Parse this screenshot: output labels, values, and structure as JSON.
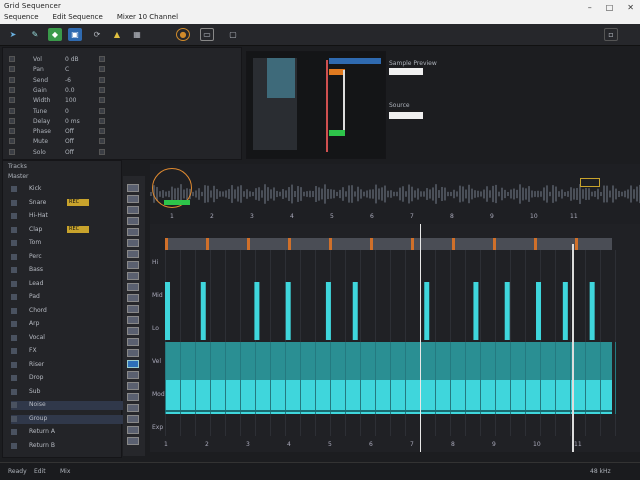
{
  "window": {
    "title": "Grid Sequencer",
    "menu": [
      "Sequence",
      "Edit Sequence",
      "Mixer 10 Channel"
    ]
  },
  "toolbar": {
    "icons": [
      "cursor-icon",
      "pencil-icon",
      "snap-icon",
      "save-icon",
      "loop-icon",
      "metronome-icon",
      "record-icon",
      "settings-icon",
      "grid-icon",
      "window-icon"
    ]
  },
  "inspector": {
    "rows": [
      {
        "label": "Vol",
        "value": "0 dB"
      },
      {
        "label": "Pan",
        "value": "C"
      },
      {
        "label": "Send",
        "value": "-6"
      },
      {
        "label": "Gain",
        "value": "0.0"
      },
      {
        "label": "Width",
        "value": "100"
      },
      {
        "label": "Tune",
        "value": "0"
      },
      {
        "label": "Delay",
        "value": "0 ms"
      },
      {
        "label": "Phase",
        "value": "Off"
      },
      {
        "label": "Mute",
        "value": "Off"
      },
      {
        "label": "Solo",
        "value": "Off"
      }
    ]
  },
  "preview": {
    "label_a": "Sample Preview",
    "label_b": "Source"
  },
  "tracks": {
    "header": "Tracks",
    "sub": "Master",
    "items": [
      {
        "name": "Kick",
        "badge": ""
      },
      {
        "name": "Snare",
        "badge": "REC"
      },
      {
        "name": "Hi-Hat",
        "badge": ""
      },
      {
        "name": "Clap",
        "badge": "REC"
      },
      {
        "name": "Tom",
        "badge": ""
      },
      {
        "name": "Perc",
        "badge": ""
      },
      {
        "name": "Bass",
        "badge": ""
      },
      {
        "name": "Lead",
        "badge": ""
      },
      {
        "name": "Pad",
        "badge": ""
      },
      {
        "name": "Chord",
        "badge": ""
      },
      {
        "name": "Arp",
        "badge": ""
      },
      {
        "name": "Vocal",
        "badge": ""
      },
      {
        "name": "FX",
        "badge": ""
      },
      {
        "name": "Riser",
        "badge": ""
      },
      {
        "name": "Drop",
        "badge": ""
      },
      {
        "name": "Sub",
        "badge": ""
      },
      {
        "name": "Noise",
        "badge": ""
      },
      {
        "name": "Group",
        "badge": ""
      },
      {
        "name": "Return A",
        "badge": ""
      },
      {
        "name": "Return B",
        "badge": ""
      }
    ]
  },
  "timeline": {
    "bars": [
      "1",
      "2",
      "3",
      "4",
      "5",
      "6",
      "7",
      "8",
      "9",
      "10",
      "11"
    ]
  },
  "editor": {
    "rulers": [
      "1",
      "2",
      "3",
      "4",
      "5",
      "6",
      "7",
      "8",
      "9",
      "10",
      "11"
    ],
    "lanes": [
      "Hi",
      "Mid",
      "Lo",
      "Vel",
      "Mod",
      "Exp"
    ],
    "notes_top": [
      0.0,
      0.08,
      0.2,
      0.27,
      0.36,
      0.42,
      0.58,
      0.69,
      0.76,
      0.83,
      0.89,
      0.95
    ]
  },
  "status": {
    "left": [
      "Ready",
      "Edit",
      "Mix"
    ],
    "right": "48 kHz"
  },
  "colors": {
    "accent": "#3fd6dc",
    "accent_dark": "#2a8f93",
    "badge": "#c8a32c",
    "playhead": "#e8e8e8"
  }
}
